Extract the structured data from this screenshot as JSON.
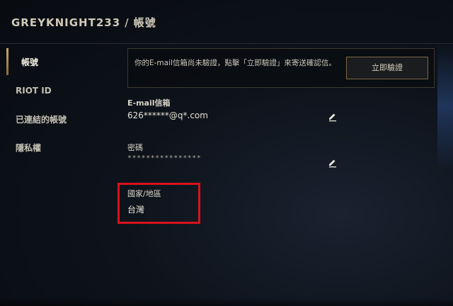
{
  "header": {
    "username": "GREYKNIGHT233",
    "separator": "/",
    "page": "帳號"
  },
  "sidebar": {
    "items": [
      {
        "label": "帳號",
        "active": true
      },
      {
        "label": "RIOT ID",
        "active": false
      },
      {
        "label": "已連結的帳號",
        "active": false
      },
      {
        "label": "隱私權",
        "active": false
      }
    ]
  },
  "notice": {
    "message": "你的E-mail信箱尚未驗證，點擊「立即驗證」來寄送確認信。",
    "button_label": "立即驗證"
  },
  "email": {
    "label": "E-mail信箱",
    "value": "626******@q*.com",
    "edit_icon": "pencil-icon"
  },
  "password": {
    "label": "密碼",
    "value": "****************",
    "edit_icon": "pencil-icon"
  },
  "region": {
    "label": "國家/地區",
    "value": "台灣",
    "highlight_color": "#d8121a"
  },
  "colors": {
    "accent_gold": "#c8a968",
    "background": "#0a0e13"
  }
}
